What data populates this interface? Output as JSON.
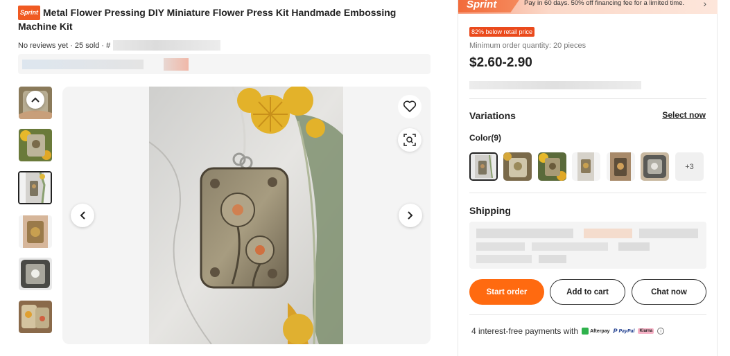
{
  "product": {
    "badge": "Sprint",
    "title": "Metal Flower Pressing DIY Miniature Flower Press Kit Handmade Embossing Machine Kit",
    "meta": "No reviews yet · 25 sold · #"
  },
  "gallery": {
    "thumb_count": 6,
    "selected_thumb": 3
  },
  "banner": {
    "tag": "Sprint",
    "text": "Pay in 60 days. 50% off financing fee for a limited time.",
    "arrow": "›"
  },
  "pricing": {
    "discount_badge": "82% below retail price",
    "moq": "Minimum order quantity: 20 pieces",
    "price": "$2.60-2.90"
  },
  "variations": {
    "title": "Variations",
    "select_link": "Select now",
    "color_label": "Color(9)",
    "more_label": "+3"
  },
  "shipping": {
    "title": "Shipping"
  },
  "actions": {
    "start_order": "Start order",
    "add_to_cart": "Add to cart",
    "chat_now": "Chat now"
  },
  "payments": {
    "text": "4 interest-free payments with",
    "afterpay": "Afterpay",
    "paypal": "PayPal",
    "klarna": "Klarna",
    "info": "i"
  },
  "colors": {
    "accent": "#ff6a10",
    "discount": "#ea4a1c",
    "sprint": "#f26b3a"
  }
}
